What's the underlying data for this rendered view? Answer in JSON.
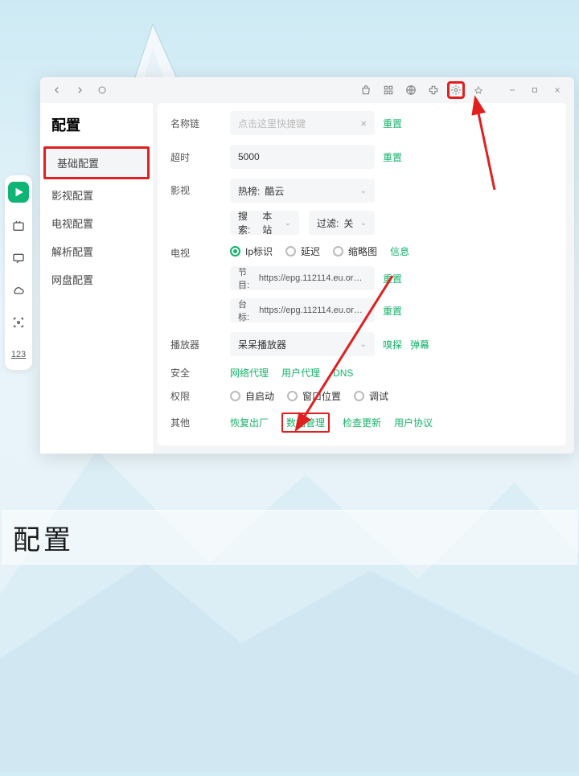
{
  "sidebar": {
    "title": "配置",
    "items": [
      "基础配置",
      "影视配置",
      "电视配置",
      "解析配置",
      "网盘配置"
    ]
  },
  "rows": {
    "name": {
      "label": "名称链",
      "placeholder": "点击这里快捷键",
      "reset": "重置"
    },
    "timeout": {
      "label": "超时",
      "value": "5000",
      "reset": "重置"
    },
    "media": {
      "label": "影视",
      "hot_label": "热榜:",
      "hot_value": "酷云",
      "search_label": "搜索:",
      "search_value": "本站",
      "filter_label": "过滤:",
      "filter_value": "关"
    },
    "tv": {
      "label": "电视",
      "radios": [
        "Ip标识",
        "延迟",
        "缩略图"
      ],
      "info": "信息",
      "epg_prefix": "节目:",
      "epg_url": "https://epg.112114.eu.org/?c...",
      "logo_prefix": "台标:",
      "logo_url": "https://epg.112114.eu.org/lo...",
      "reset": "重置"
    },
    "player": {
      "label": "播放器",
      "value": "呆呆播放器",
      "sniff": "嗅探",
      "danmu": "弹幕"
    },
    "security": {
      "label": "安全",
      "links": [
        "网络代理",
        "用户代理",
        "DNS"
      ]
    },
    "perm": {
      "label": "权限",
      "radios": [
        "自启动",
        "窗口位置",
        "调试"
      ]
    },
    "other": {
      "label": "其他",
      "links": [
        "恢复出厂",
        "数据管理",
        "检查更新",
        "用户协议"
      ]
    }
  },
  "banner": "配置"
}
